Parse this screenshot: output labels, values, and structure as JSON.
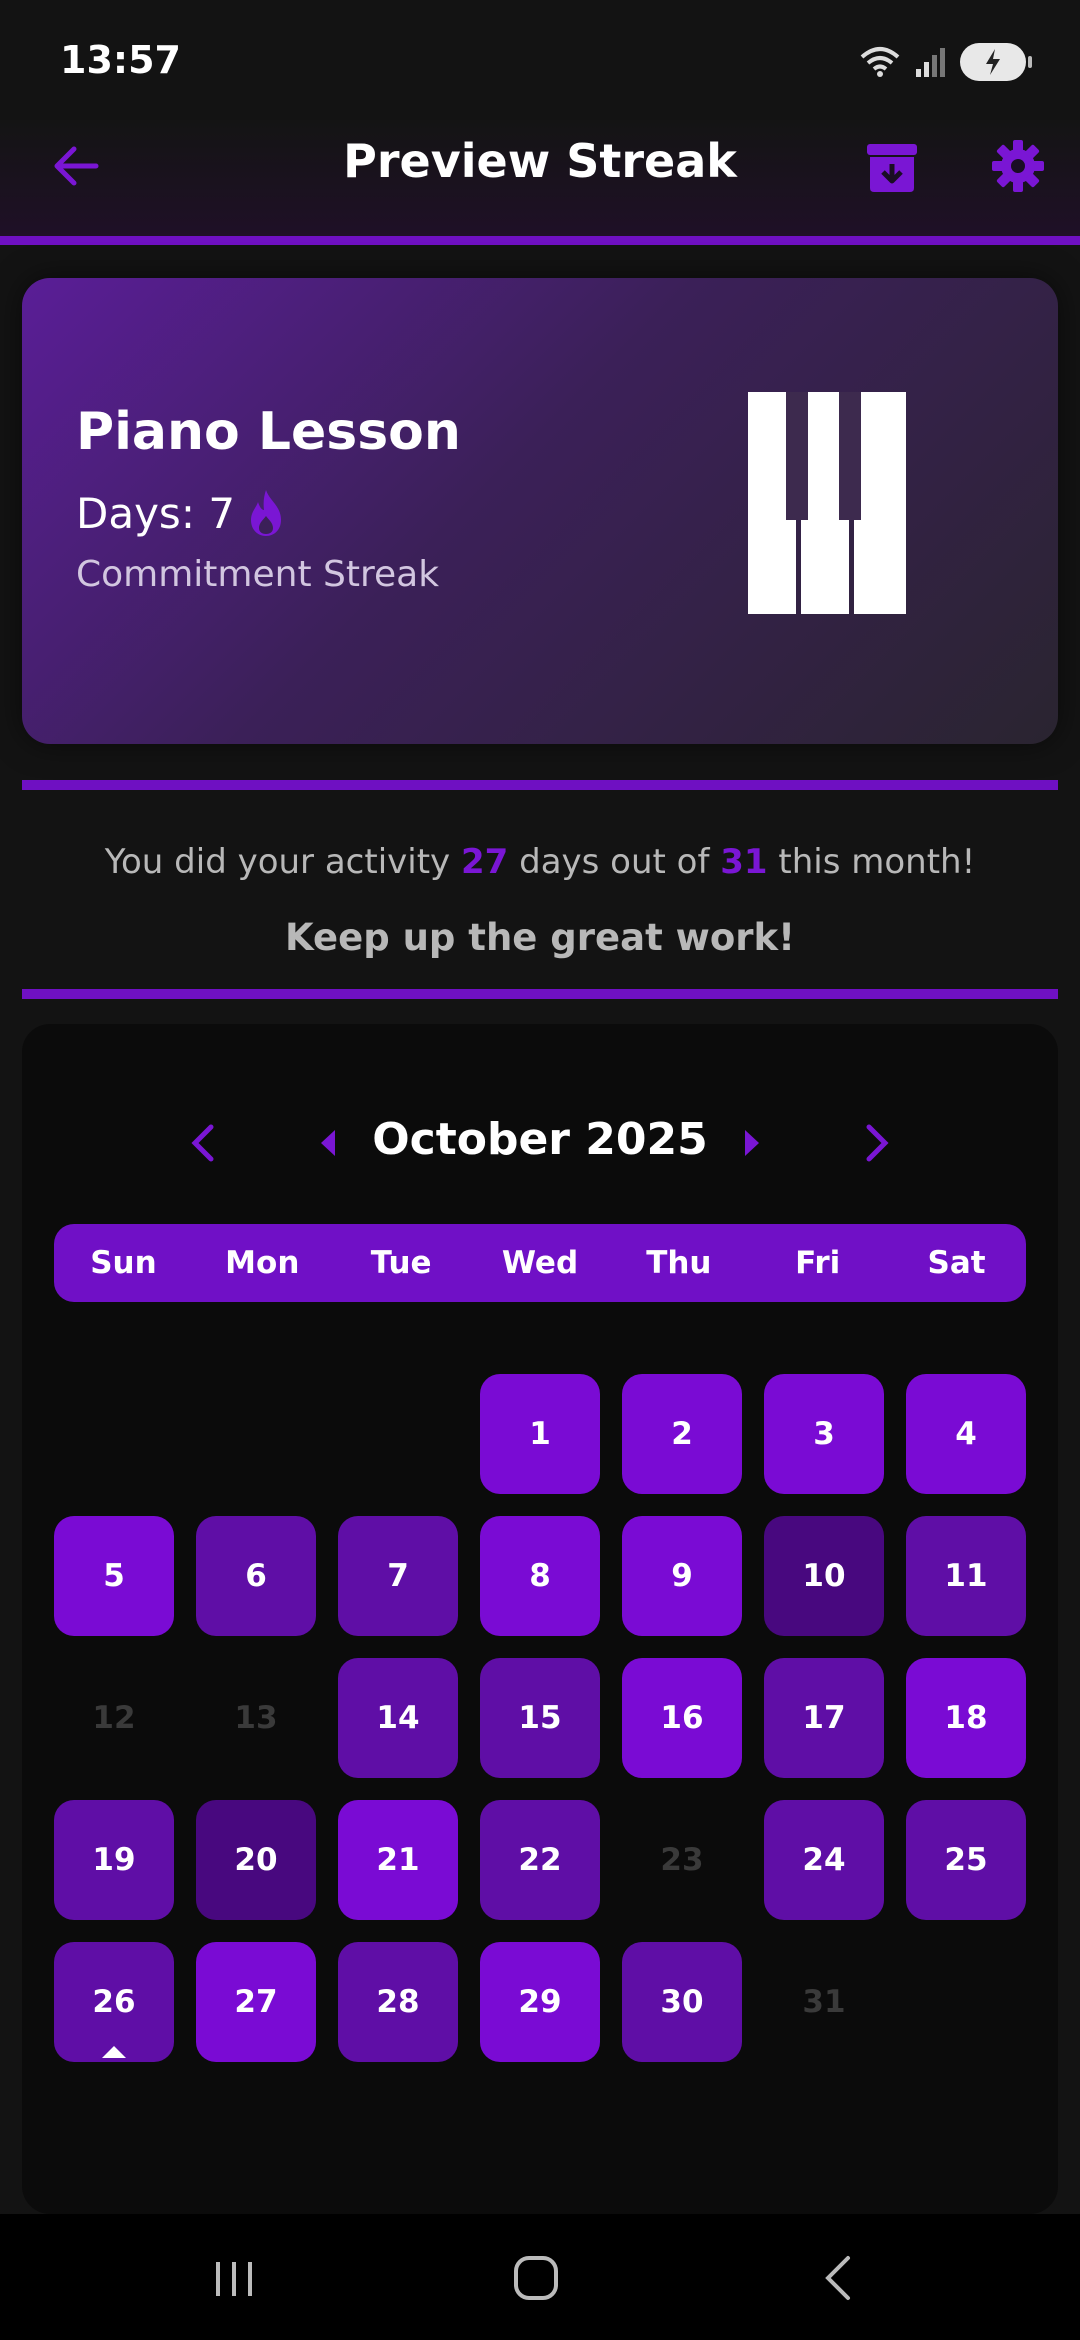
{
  "status": {
    "time": "13:57"
  },
  "header": {
    "title": "Preview Streak"
  },
  "card": {
    "title": "Piano Lesson",
    "days_label": "Days: 7",
    "subtitle": "Commitment Streak"
  },
  "summary": {
    "prefix": "You did your activity",
    "done": "27",
    "middle": "days out of",
    "total": "31",
    "suffix": "this month!",
    "encourage": "Keep up the great work!"
  },
  "calendar": {
    "month_label": "October 2025",
    "weekdays": [
      "Sun",
      "Mon",
      "Tue",
      "Wed",
      "Thu",
      "Fri",
      "Sat"
    ],
    "today": "26",
    "days": [
      {
        "d": "1",
        "level": 3
      },
      {
        "d": "2",
        "level": 3
      },
      {
        "d": "3",
        "level": 3
      },
      {
        "d": "4",
        "level": 3
      },
      {
        "d": "5",
        "level": 3
      },
      {
        "d": "6",
        "level": 2
      },
      {
        "d": "7",
        "level": 2
      },
      {
        "d": "8",
        "level": 3
      },
      {
        "d": "9",
        "level": 3
      },
      {
        "d": "10",
        "level": 1
      },
      {
        "d": "11",
        "level": 2
      },
      {
        "d": "12",
        "level": 0
      },
      {
        "d": "13",
        "level": 0
      },
      {
        "d": "14",
        "level": 2
      },
      {
        "d": "15",
        "level": 2
      },
      {
        "d": "16",
        "level": 3
      },
      {
        "d": "17",
        "level": 2
      },
      {
        "d": "18",
        "level": 3
      },
      {
        "d": "19",
        "level": 2
      },
      {
        "d": "20",
        "level": 1
      },
      {
        "d": "21",
        "level": 3
      },
      {
        "d": "22",
        "level": 2
      },
      {
        "d": "23",
        "level": 0
      },
      {
        "d": "24",
        "level": 2
      },
      {
        "d": "25",
        "level": 2
      },
      {
        "d": "26",
        "level": 2
      },
      {
        "d": "27",
        "level": 3
      },
      {
        "d": "28",
        "level": 2
      },
      {
        "d": "29",
        "level": 3
      },
      {
        "d": "30",
        "level": 2
      },
      {
        "d": "31",
        "level": 0
      }
    ]
  },
  "colors": {
    "accent": "#7010c6",
    "background": "#131313"
  },
  "icons": [
    "back-arrow-icon",
    "archive-icon",
    "gear-icon",
    "flame-icon",
    "piano-icon",
    "chevron-left-icon",
    "caret-left-icon",
    "caret-right-icon",
    "chevron-right-icon"
  ]
}
